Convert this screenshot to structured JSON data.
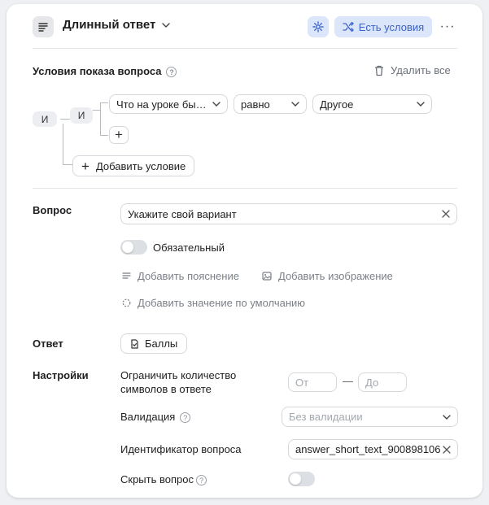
{
  "header": {
    "title": "Длинный ответ",
    "conditions_button": "Есть условия",
    "more": "···"
  },
  "conditions": {
    "title": "Условия показа вопроса",
    "help": "?",
    "delete_all": "Удалить все",
    "outer_logic": "И",
    "inner_logic": "И",
    "rule": {
      "field": "Что на уроке бы…",
      "operator": "равно",
      "value": "Другое"
    },
    "add_button": "+",
    "add_condition": "Добавить условие"
  },
  "question": {
    "label": "Вопрос",
    "value": "Укажите свой вариант",
    "required_label": "Обязательный",
    "add_hint": "Добавить пояснение",
    "add_image": "Добавить изображение",
    "add_default": "Добавить значение по умолчанию"
  },
  "answer": {
    "label": "Ответ",
    "points_button": "Баллы"
  },
  "settings": {
    "label": "Настройки",
    "limit_label_line1": "Ограничить количество",
    "limit_label_line2": "символов в ответе",
    "from_placeholder": "От",
    "dash": "—",
    "to_placeholder": "До",
    "validation_label": "Валидация",
    "validation_placeholder": "Без валидации",
    "id_label": "Идентификатор вопроса",
    "id_value": "answer_short_text_900898106",
    "hide_label": "Скрыть вопрос"
  },
  "colors": {
    "accent": "#3d63c9",
    "accent_bg": "#dbe6fb",
    "muted": "#7b8089"
  }
}
